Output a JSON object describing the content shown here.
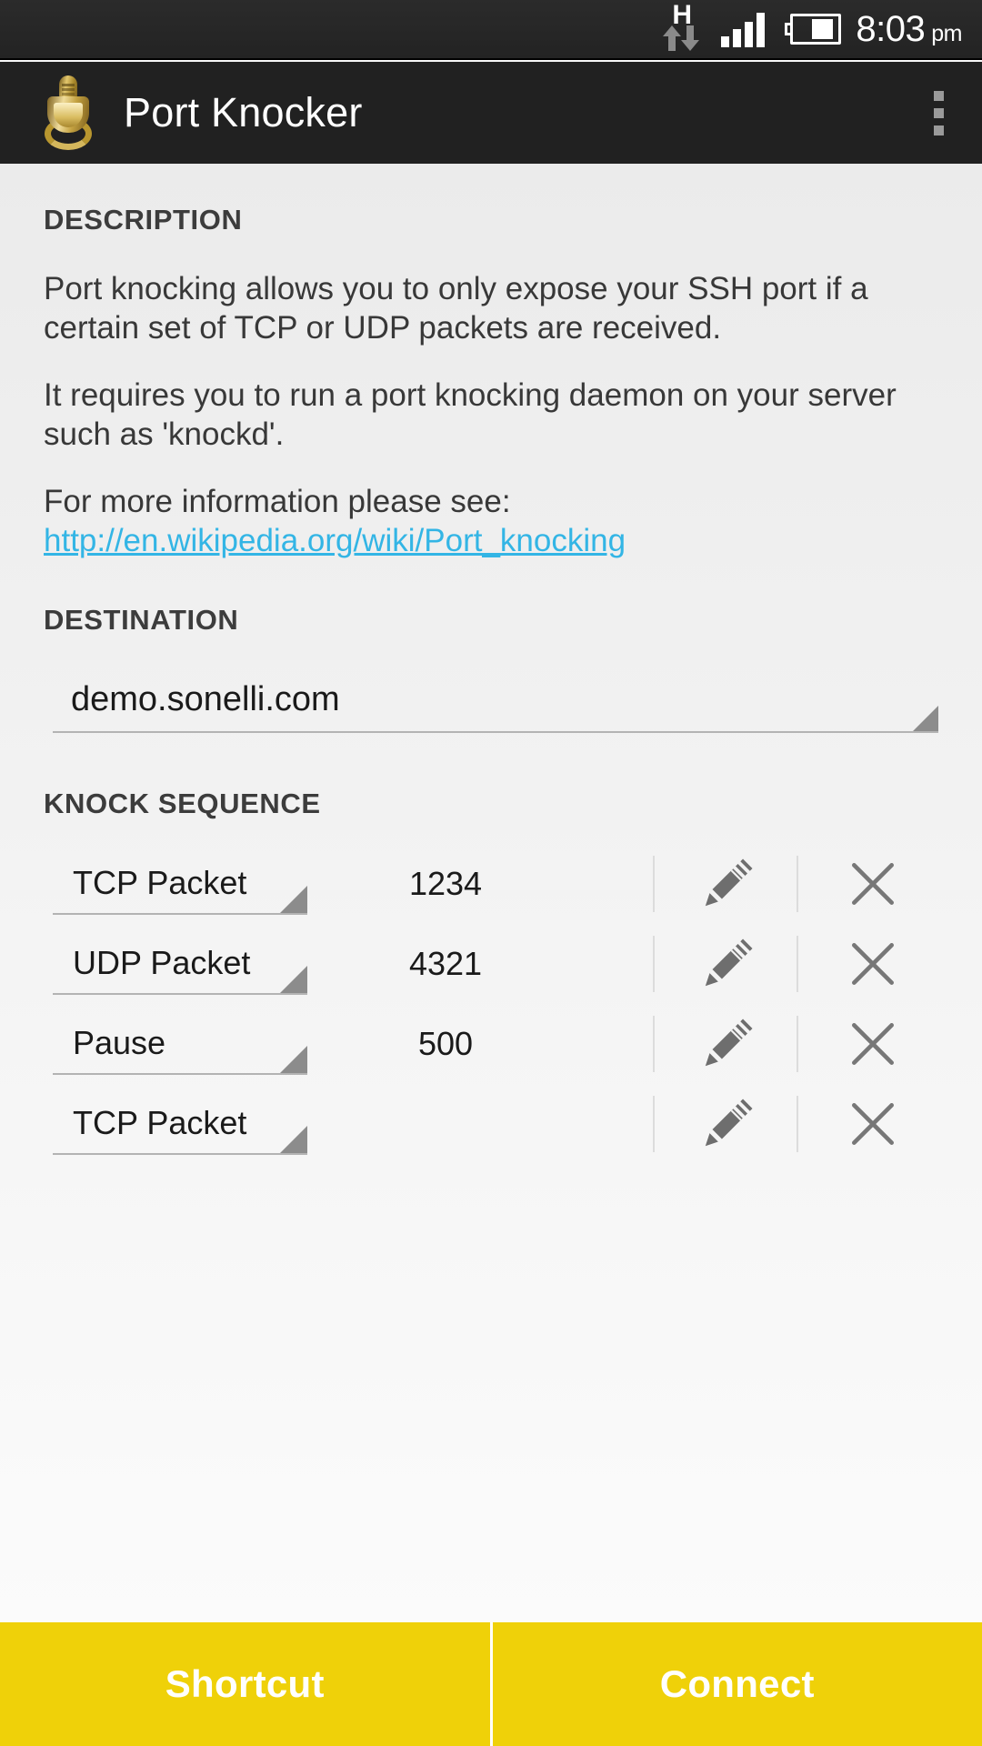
{
  "status_bar": {
    "network_type": "H",
    "network_icon": "hspa-data-icon",
    "signal_icon": "signal-bars-icon",
    "battery_icon": "battery-icon",
    "time": "8:03",
    "ampm": "pm"
  },
  "action_bar": {
    "app_icon": "door-knocker-icon",
    "title": "Port Knocker",
    "overflow_icon": "overflow-menu-icon"
  },
  "description": {
    "header": "DESCRIPTION",
    "paragraph1": "Port knocking allows you to only expose your SSH port if a certain set of TCP or UDP packets are received.",
    "paragraph2": "It requires you to run a port knocking daemon on your server such as 'knockd'.",
    "link_lead": "For more information please see:",
    "link_text": "http://en.wikipedia.org/wiki/Port_knocking",
    "link_color": "#33b5e5"
  },
  "destination": {
    "header": "DESTINATION",
    "selected": "demo.sonelli.com"
  },
  "knock_sequence": {
    "header": "KNOCK SEQUENCE",
    "rows": [
      {
        "type": "TCP Packet",
        "value": "1234",
        "edit_icon": "pencil-icon",
        "delete_icon": "close-x-icon"
      },
      {
        "type": "UDP Packet",
        "value": "4321",
        "edit_icon": "pencil-icon",
        "delete_icon": "close-x-icon"
      },
      {
        "type": "Pause",
        "value": "500",
        "edit_icon": "pencil-icon",
        "delete_icon": "close-x-icon"
      },
      {
        "type": "TCP Packet",
        "value": "",
        "edit_icon": "pencil-icon",
        "delete_icon": "close-x-icon"
      }
    ]
  },
  "buttons": {
    "shortcut": "Shortcut",
    "connect": "Connect",
    "accent_color": "#EFD109"
  }
}
